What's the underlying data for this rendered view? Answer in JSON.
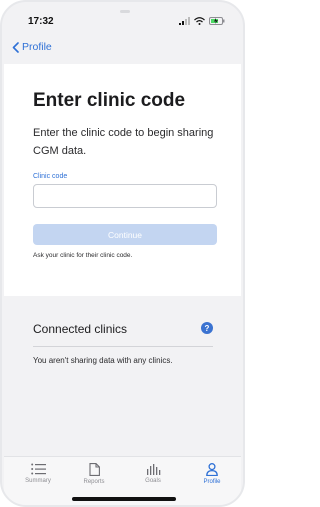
{
  "status_bar": {
    "time": "17:32"
  },
  "nav": {
    "back_label": "Profile"
  },
  "main": {
    "title": "Enter clinic code",
    "subtitle": "Enter the clinic code to begin sharing CGM data.",
    "field_label": "Clinic code",
    "field_value": "",
    "field_placeholder": "",
    "continue_label": "Continue",
    "helper_text": "Ask your clinic for their clinic code."
  },
  "connected": {
    "title": "Connected clinics",
    "help_glyph": "?",
    "empty_message": "You aren't sharing data with any clinics."
  },
  "tabs": [
    {
      "label": "Summary",
      "icon": "list-icon",
      "active": false
    },
    {
      "label": "Reports",
      "icon": "document-icon",
      "active": false
    },
    {
      "label": "Goals",
      "icon": "bar-chart-icon",
      "active": false
    },
    {
      "label": "Profile",
      "icon": "person-icon",
      "active": true
    }
  ],
  "colors": {
    "accent": "#2f71d6",
    "button_disabled": "#c3d5f1",
    "background": "#f2f2f4",
    "help_icon": "#3b73d1"
  }
}
